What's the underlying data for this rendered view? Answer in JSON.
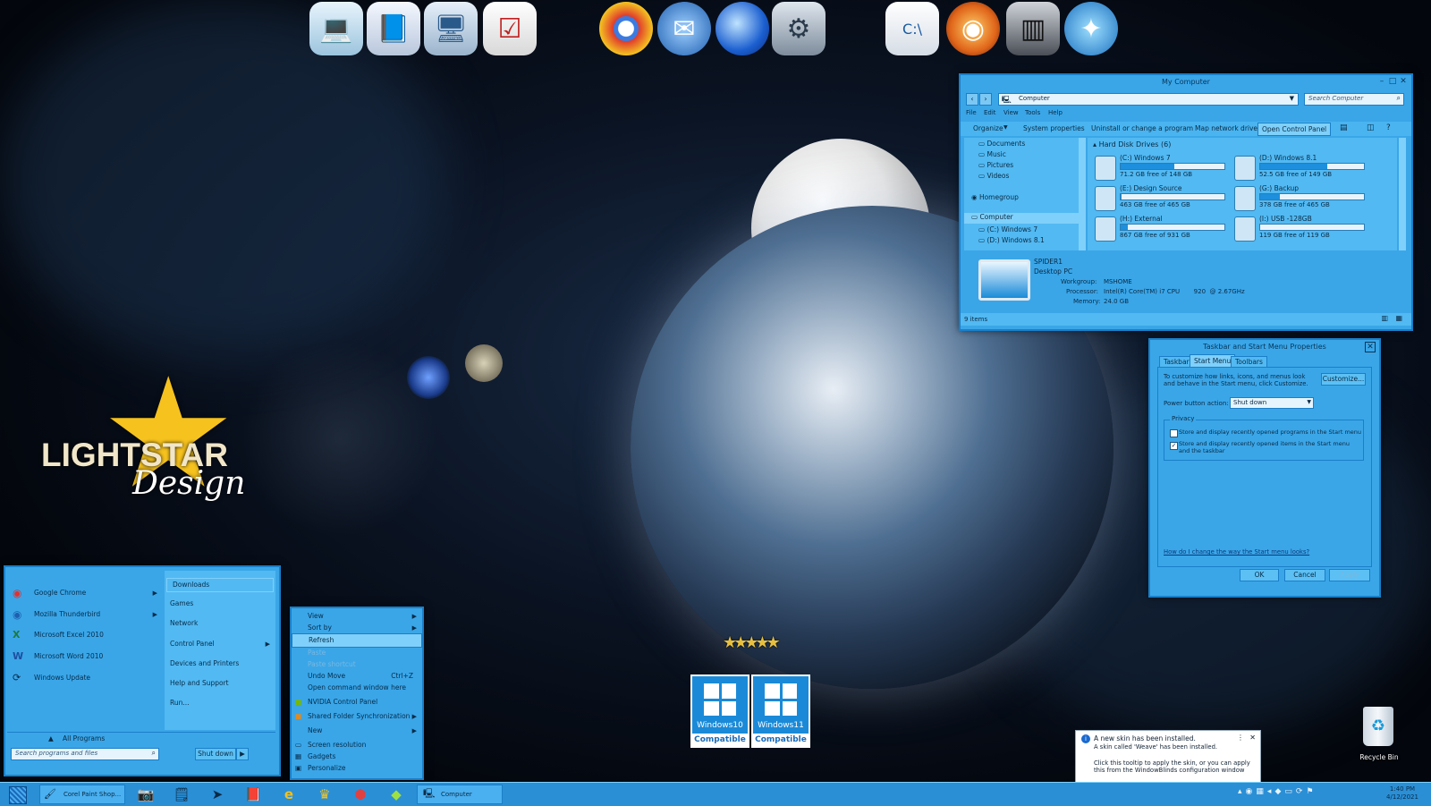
{
  "explorer": {
    "title": "My Computer",
    "address": "Computer",
    "search_placeholder": "Search Computer",
    "menu": [
      "File",
      "Edit",
      "View",
      "Tools",
      "Help"
    ],
    "toolbar": [
      "Organize",
      "System properties",
      "Uninstall or change a program",
      "Map network drive",
      "Open Control Panel"
    ],
    "nav": {
      "documents": "Documents",
      "music": "Music",
      "pictures": "Pictures",
      "videos": "Videos",
      "homegroup": "Homegroup",
      "computer": "Computer",
      "c": "(C:) Windows 7",
      "d": "(D:) Windows 8.1"
    },
    "section": "Hard Disk Drives (6)",
    "drives": [
      {
        "name": "(C:) Windows 7",
        "free": "71.2 GB free of 148 GB",
        "used": 0.52
      },
      {
        "name": "(D:) Windows 8.1",
        "free": "52.5 GB free of 149 GB",
        "used": 0.65
      },
      {
        "name": "(E:) Design Source",
        "free": "463 GB free of 465 GB",
        "used": 0.01
      },
      {
        "name": "(G:) Backup",
        "free": "378 GB free of 465 GB",
        "used": 0.19
      },
      {
        "name": "(H:) External",
        "free": "867 GB free of 931 GB",
        "used": 0.07
      },
      {
        "name": "(I:) USB -128GB",
        "free": "119 GB free of 119 GB",
        "used": 0.0
      }
    ],
    "details": {
      "name": "SPIDER1",
      "type": "Desktop PC",
      "workgroup_label": "Workgroup:",
      "workgroup": "MSHOME",
      "processor_label": "Processor:",
      "processor": "Intel(R) Core(TM) i7 CPU       920  @ 2.67GHz",
      "memory_label": "Memory:",
      "memory": "24.0 GB"
    },
    "status": "9 items"
  },
  "taskbar_props": {
    "title": "Taskbar and Start Menu Properties",
    "tabs": [
      "Taskbar",
      "Start Menu",
      "Toolbars"
    ],
    "desc": "To customize how links, icons, and menus look and behave in the Start menu, click Customize.",
    "customize": "Customize...",
    "power_label": "Power button action:",
    "power_value": "Shut down",
    "privacy": "Privacy",
    "check1": "Store and display recently opened programs in the Start menu",
    "check2": "Store and display recently opened items in the Start menu and the taskbar",
    "link": "How do I change the way the Start menu looks?",
    "ok": "OK",
    "cancel": "Cancel",
    "apply": "Apply"
  },
  "start_menu": {
    "programs": [
      "Google Chrome",
      "Mozilla Thunderbird",
      "Microsoft Excel 2010",
      "Microsoft Word 2010",
      "Windows Update"
    ],
    "places": [
      "Downloads",
      "Games",
      "Network",
      "Control Panel",
      "Devices and Printers",
      "Help and Support",
      "Run..."
    ],
    "all_programs": "All Programs",
    "search_placeholder": "Search programs and files",
    "shutdown": "Shut down"
  },
  "context_menu": {
    "items": [
      "View",
      "Sort by",
      "Refresh",
      "Paste",
      "Paste shortcut",
      "Undo Move",
      "Open command window here",
      "NVIDIA Control Panel",
      "Shared Folder Synchronization",
      "New",
      "Screen resolution",
      "Gadgets",
      "Personalize"
    ],
    "undo_shortcut": "Ctrl+Z"
  },
  "logo": {
    "main": "LIGHTSTAR",
    "script": "Design"
  },
  "badges": [
    {
      "name": "Windows10",
      "label": "Compatible"
    },
    {
      "name": "Windows11",
      "label": "Compatible"
    }
  ],
  "notification": {
    "title": "A new skin has been installed.",
    "line1": "A skin called 'Weave' has been installed.",
    "line2": "Click this tooltip to apply the skin, or you can apply this from the WindowBlinds configuration window"
  },
  "recycle_bin": "Recycle Bin",
  "taskbar": {
    "task1": "Corel Paint Shop...",
    "task2": "Computer",
    "time": "1:40 PM",
    "date": "4/12/2021"
  },
  "colors": {
    "accent": "#3aa6e8",
    "border": "#1a7fc8",
    "taskbar": "#2b8fd6"
  }
}
